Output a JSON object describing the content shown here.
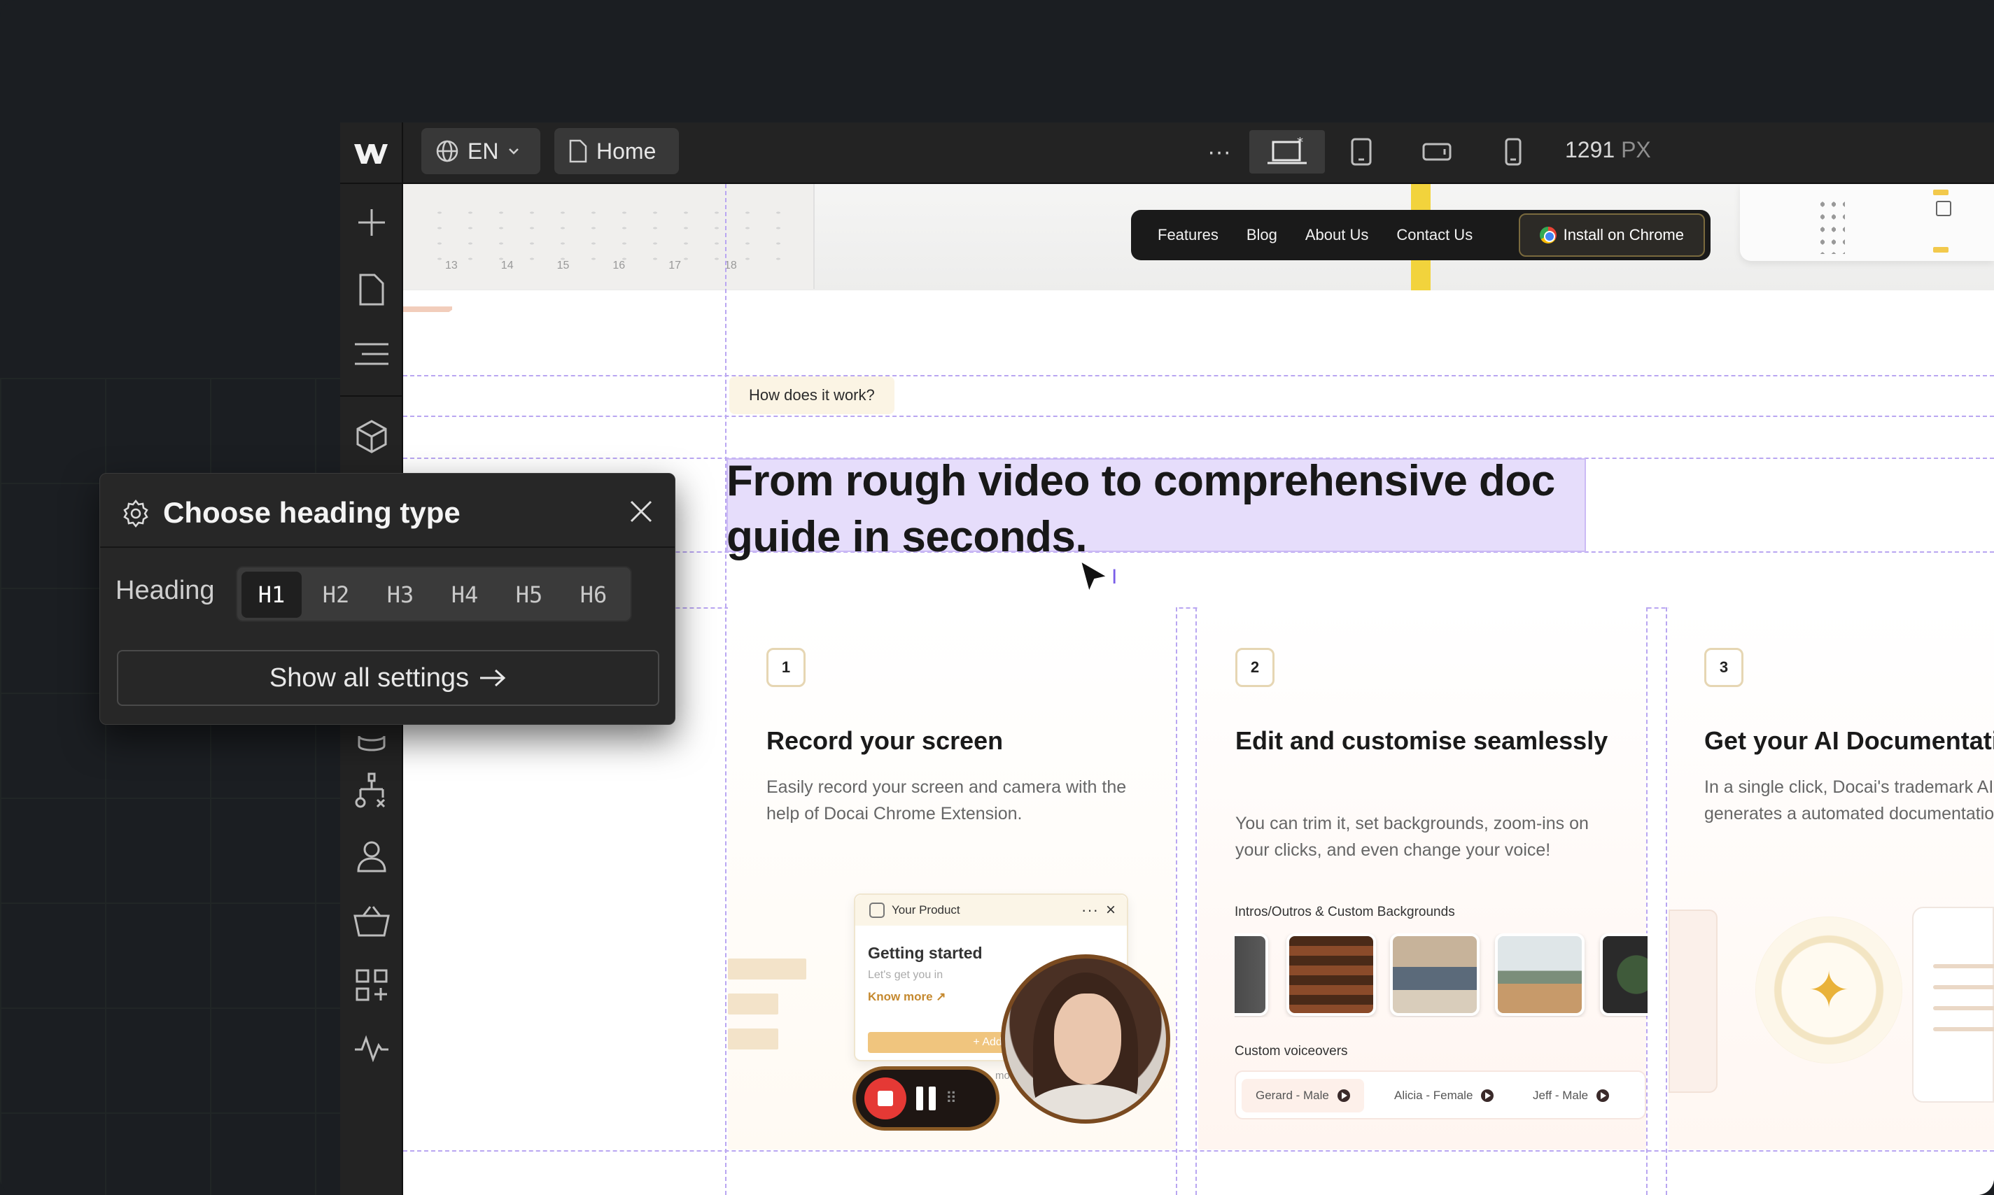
{
  "editor": {
    "lang": "EN",
    "page": "Home",
    "more": "···",
    "width_value": "1291",
    "width_unit": "PX"
  },
  "site_nav": {
    "links": [
      "Features",
      "Blog",
      "About Us",
      "Contact Us"
    ],
    "install": "Install on Chrome"
  },
  "ruler_numbers": [
    "13",
    "14",
    "15",
    "16",
    "17",
    "18"
  ],
  "section": {
    "eyebrow": "How does it work?",
    "headline": "From rough video to comprehensive doc guide in seconds."
  },
  "cards": [
    {
      "num": "1",
      "title": "Record your screen",
      "desc": "Easily record your screen and camera with the help of Docai Chrome Extension."
    },
    {
      "num": "2",
      "title": "Edit and customise seamlessly",
      "desc": "You can trim it, set backgrounds, zoom-ins on your clicks, and even change your voice!"
    },
    {
      "num": "3",
      "title": "Get your AI Documentation",
      "desc": "In a single click, Docai's trademark AI generates a automated documentation"
    }
  ],
  "card1_popup": {
    "product": "Your Product",
    "title": "Getting started",
    "sub": "Let's get you in",
    "more": "Know more",
    "add": "+ Add m",
    "move": "mov"
  },
  "card2": {
    "backgrounds_caption": "Intros/Outros & Custom Backgrounds",
    "voiceovers_caption": "Custom voiceovers",
    "voices": [
      "Gerard - Male",
      "Alicia - Female",
      "Jeff - Male"
    ]
  },
  "panel": {
    "title": "Choose heading type",
    "heading_label": "Heading",
    "levels": [
      "H1",
      "H2",
      "H3",
      "H4",
      "H5",
      "H6"
    ],
    "selected": "H1",
    "show_all": "Show all settings"
  },
  "colors": {
    "selection": "#e6ddfb",
    "guide": "#b9a6f1",
    "record": "#e53935"
  }
}
